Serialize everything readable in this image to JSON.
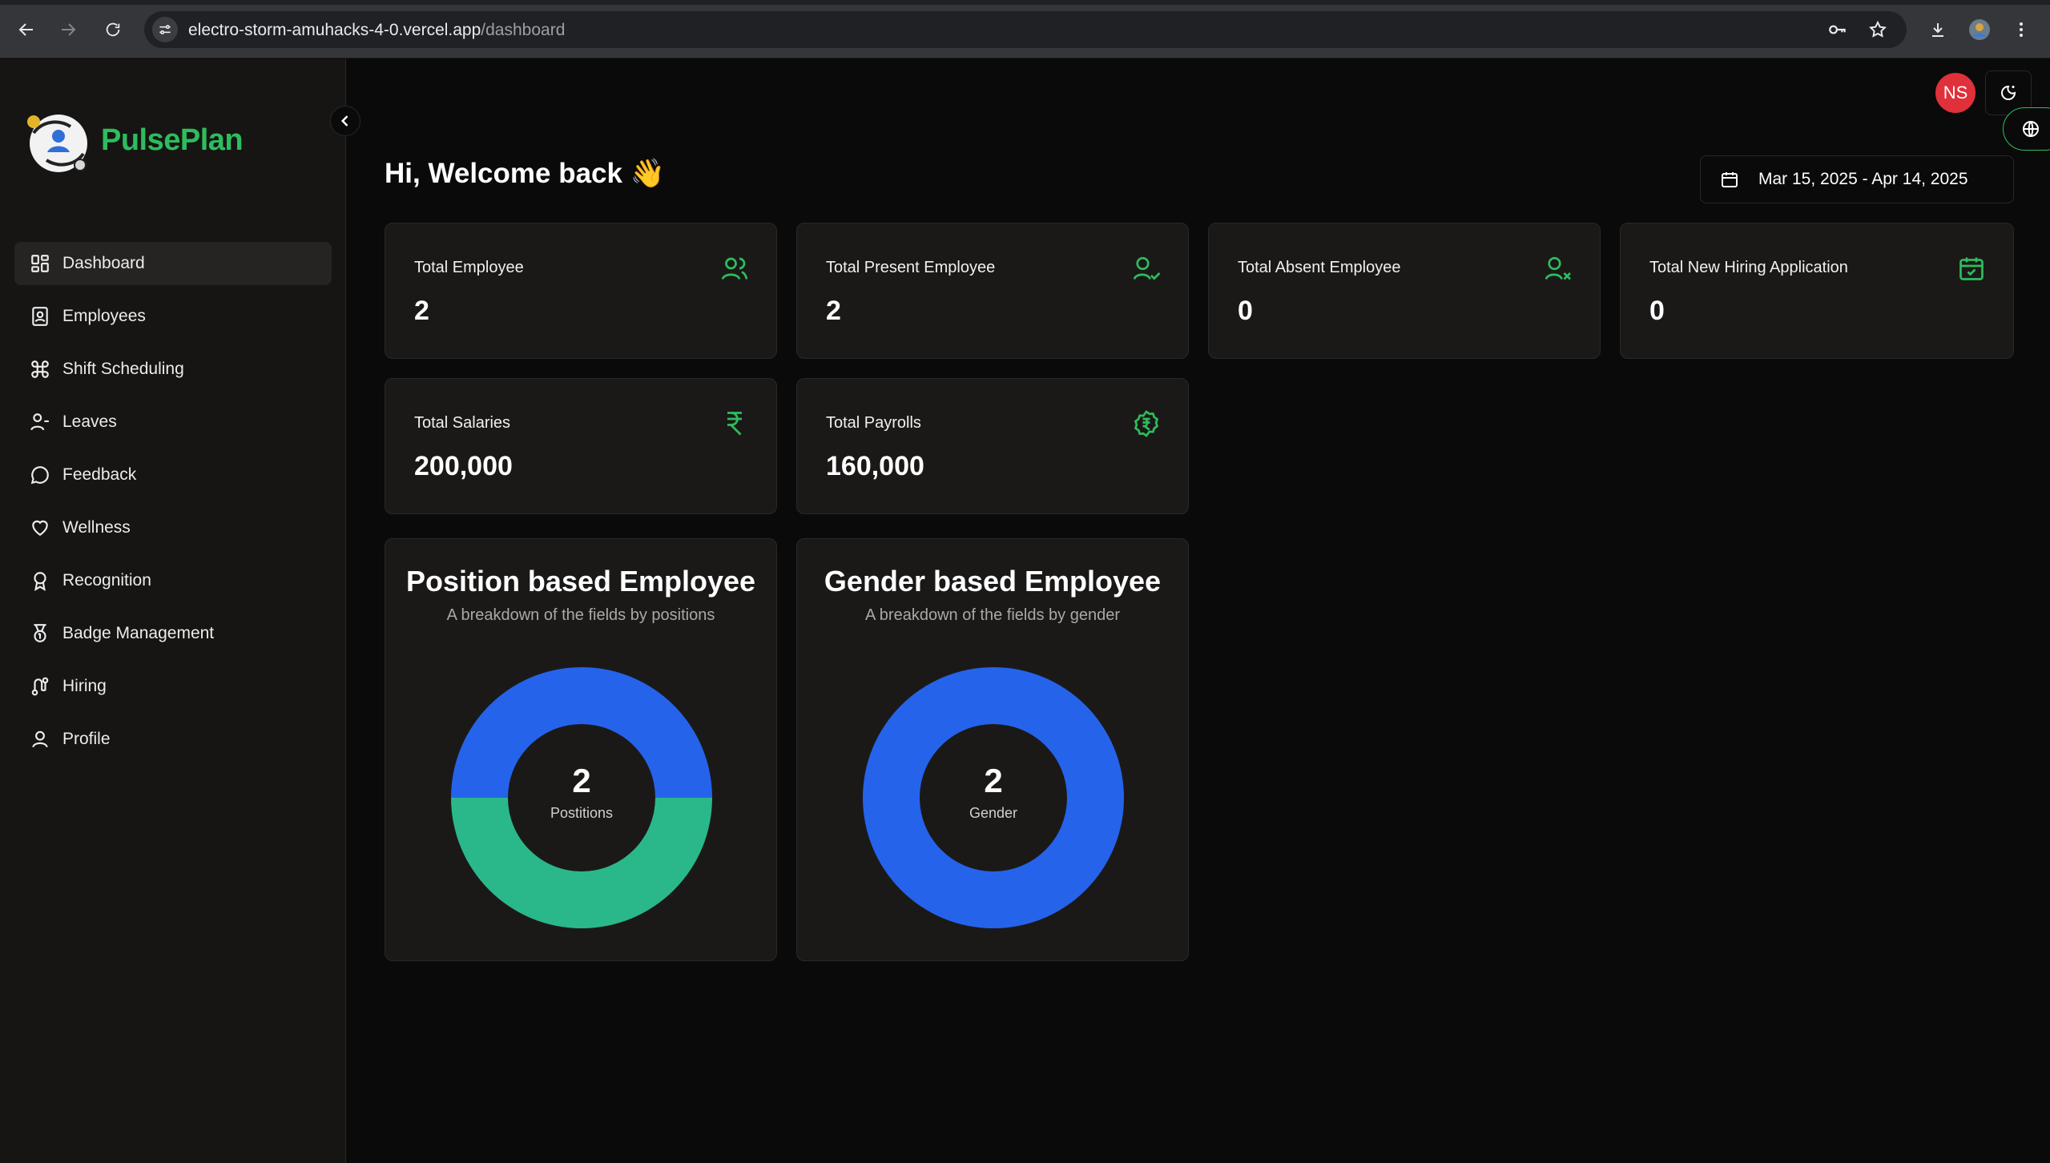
{
  "browser": {
    "url_host": "electro-storm-amuhacks-4-0.vercel.app",
    "url_path": "/dashboard"
  },
  "app": {
    "brand": "PulsePlan"
  },
  "sidebar": {
    "items": [
      {
        "label": "Dashboard",
        "icon": "dashboard-icon",
        "active": true
      },
      {
        "label": "Employees",
        "icon": "employees-icon"
      },
      {
        "label": "Shift Scheduling",
        "icon": "command-icon"
      },
      {
        "label": "Leaves",
        "icon": "user-minus-icon"
      },
      {
        "label": "Feedback",
        "icon": "message-circle-icon"
      },
      {
        "label": "Wellness",
        "icon": "heart-icon"
      },
      {
        "label": "Recognition",
        "icon": "award-icon"
      },
      {
        "label": "Badge Management",
        "icon": "medal-icon"
      },
      {
        "label": "Hiring",
        "icon": "route-icon"
      },
      {
        "label": "Profile",
        "icon": "user-icon"
      }
    ]
  },
  "header": {
    "avatar_initials": "NS",
    "welcome": "Hi, Welcome back 👋",
    "date_range": "Mar 15, 2025 - Apr 14, 2025"
  },
  "stats": [
    {
      "label": "Total Employee",
      "value": "2",
      "icon": "users-icon"
    },
    {
      "label": "Total Present Employee",
      "value": "2",
      "icon": "user-check-icon"
    },
    {
      "label": "Total Absent Employee",
      "value": "0",
      "icon": "user-x-icon"
    },
    {
      "label": "Total New Hiring Application",
      "value": "0",
      "icon": "calendar-check-icon"
    },
    {
      "label": "Total Salaries",
      "value": "200,000",
      "icon": "rupee-icon"
    },
    {
      "label": "Total Payrolls",
      "value": "160,000",
      "icon": "rupee-badge-icon"
    }
  ],
  "charts": {
    "position": {
      "title": "Position based Employee",
      "subtitle": "A breakdown of the fields by positions",
      "center_value": "2",
      "center_label": "Postitions"
    },
    "gender": {
      "title": "Gender based Employee",
      "subtitle": "A breakdown of the fields by gender",
      "center_value": "2",
      "center_label": "Gender"
    }
  },
  "colors": {
    "accent": "#2dbd5d",
    "blue": "#2563eb",
    "teal": "#2ab88a",
    "avatar": "#e0303a"
  },
  "chart_data": [
    {
      "type": "pie",
      "title": "Position based Employee",
      "categories": [
        "",
        ""
      ],
      "values": [
        1,
        1
      ],
      "colors": [
        "#2563eb",
        "#2ab88a"
      ],
      "total": 2
    },
    {
      "type": "pie",
      "title": "Gender based Employee",
      "categories": [
        ""
      ],
      "values": [
        2
      ],
      "colors": [
        "#2563eb"
      ],
      "total": 2
    }
  ]
}
